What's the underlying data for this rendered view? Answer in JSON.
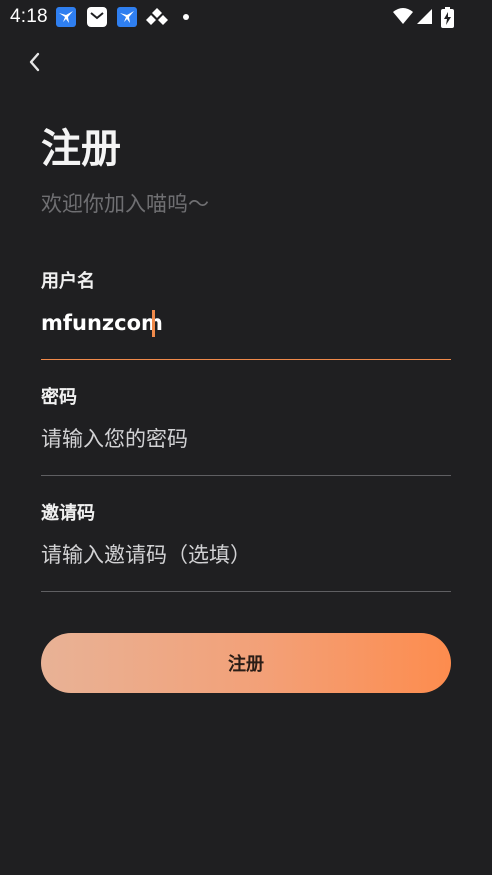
{
  "status_bar": {
    "time": "4:18"
  },
  "header": {
    "back_icon": "chevron-left-icon"
  },
  "page": {
    "title": "注册",
    "subtitle": "欢迎你加入喵呜～"
  },
  "form": {
    "username": {
      "label": "用户名",
      "value": "mfunzcom",
      "placeholder": ""
    },
    "password": {
      "label": "密码",
      "value": "",
      "placeholder": "请输入您的密码"
    },
    "invite_code": {
      "label": "邀请码",
      "value": "",
      "placeholder": "请输入邀请码（选填）"
    },
    "submit_label": "注册"
  },
  "colors": {
    "background": "#1f1f21",
    "accent": "#f08a4b",
    "button_gradient_start": "#e8b296",
    "button_gradient_end": "#fd8c4e"
  }
}
